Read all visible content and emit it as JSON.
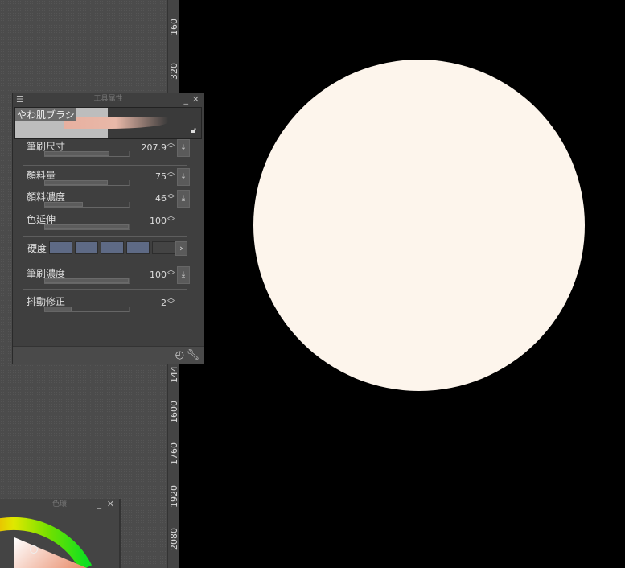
{
  "ruler": {
    "labels": [
      "160",
      "320",
      "144",
      "1600",
      "1760",
      "1920",
      "2080"
    ]
  },
  "tool_panel": {
    "title": "工具属性",
    "brush_name": "やわ肌ブラシ",
    "rows": [
      {
        "label": "筆刷尺寸",
        "value": "207.9",
        "fill": 0.77,
        "download": true
      },
      {
        "label": "顏料量",
        "value": "75",
        "fill": 0.75,
        "download": true
      },
      {
        "label": "顏料濃度",
        "value": "46",
        "fill": 0.46,
        "download": true
      },
      {
        "label": "色延伸",
        "value": "100",
        "fill": 1.0,
        "download": false
      },
      {
        "label": "筆刷濃度",
        "value": "100",
        "fill": 1.0,
        "download": true
      },
      {
        "label": "抖動修正",
        "value": "2",
        "fill": 0.32,
        "download": false
      }
    ],
    "hardness_label": "硬度",
    "hardness_level": 4,
    "hardness_steps": 5
  },
  "color_panel": {
    "title": "色環"
  },
  "canvas": {
    "fill_color": "#fdf5ec",
    "background": "#000000"
  }
}
